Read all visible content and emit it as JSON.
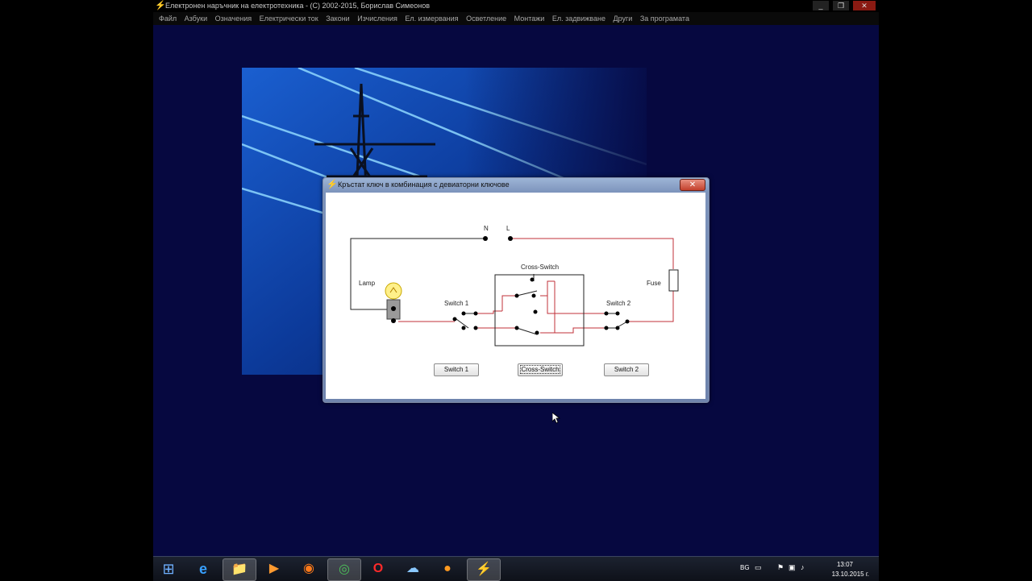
{
  "window": {
    "title": "Електронен наръчник на електротехника - (C) 2002-2015, Борислав Симеонов",
    "controls": {
      "minimize": "_",
      "maximize": "❐",
      "close": "✕"
    }
  },
  "menu": [
    "Файл",
    "Азбуки",
    "Означения",
    "Електрически ток",
    "Закони",
    "Изчисления",
    "Ел. измервания",
    "Осветление",
    "Монтажи",
    "Ел. задвижване",
    "Други",
    "За програмата"
  ],
  "dialog": {
    "title": "Кръстат ключ в комбинация с девиаторни ключове",
    "close": "✕",
    "labels": {
      "n": "N",
      "l": "L",
      "cross": "Cross-Switch",
      "lamp": "Lamp",
      "fuse": "Fuse",
      "sw1": "Switch 1",
      "sw2": "Switch 2"
    },
    "buttons": {
      "sw1": "Switch 1",
      "cross": "Cross-Switch",
      "sw2": "Switch 2"
    }
  },
  "taskbar": {
    "start": "⊞",
    "apps": [
      {
        "name": "internet-explorer",
        "glyph": "e"
      },
      {
        "name": "file-explorer",
        "glyph": "📁"
      },
      {
        "name": "media-player",
        "glyph": "▶"
      },
      {
        "name": "firefox",
        "glyph": "◉"
      },
      {
        "name": "chrome",
        "glyph": "◎"
      },
      {
        "name": "opera",
        "glyph": "O"
      },
      {
        "name": "messenger",
        "glyph": "☁"
      },
      {
        "name": "orange-app",
        "glyph": "●"
      },
      {
        "name": "electro-app",
        "glyph": "⚡"
      }
    ],
    "tray": {
      "lang": "BG",
      "time": "13:07",
      "date": "13.10.2015 г."
    }
  },
  "colors": {
    "desktop": "#060840",
    "wire_red": "#c0303a",
    "wire_black": "#222222",
    "accent_yellow": "#ffd21a"
  }
}
